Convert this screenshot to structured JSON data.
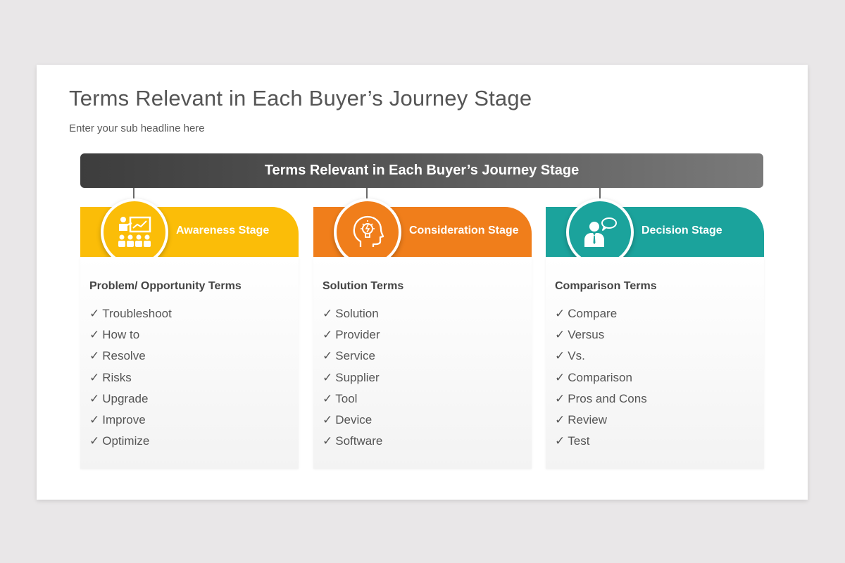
{
  "title": "Terms Relevant in Each Buyer’s Journey Stage",
  "subtitle": "Enter your sub headline here",
  "banner": "Terms Relevant in Each Buyer’s Journey Stage",
  "check_mark": "✓",
  "colors": {
    "awareness": "#fbbd08",
    "consideration": "#f07e1b",
    "decision": "#1ba39c",
    "banner_dark": "#3d3d3d",
    "banner_light": "#7a7a7a"
  },
  "stages": [
    {
      "label": "Awareness Stage",
      "icon": "presentation-audience-icon",
      "heading": "Problem/ Opportunity Terms",
      "terms": [
        "Troubleshoot",
        "How to",
        "Resolve",
        "Risks",
        "Upgrade",
        "Improve",
        "Optimize"
      ]
    },
    {
      "label": "Consideration Stage",
      "icon": "head-lightbulb-icon",
      "heading": "Solution Terms",
      "terms": [
        "Solution",
        "Provider",
        "Service",
        "Supplier",
        "Tool",
        "Device",
        "Software"
      ]
    },
    {
      "label": "Decision Stage",
      "icon": "businessman-speech-bubble-icon",
      "heading": "Comparison Terms",
      "terms": [
        "Compare",
        "Versus",
        "Vs.",
        "Comparison",
        "Pros and Cons",
        "Review",
        "Test"
      ]
    }
  ]
}
